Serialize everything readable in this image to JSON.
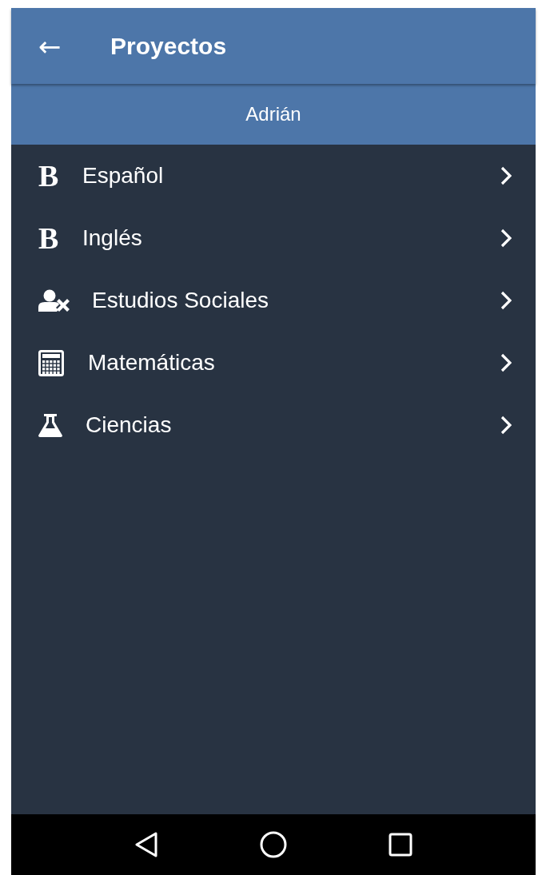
{
  "app_bar": {
    "back_icon": "←",
    "title": "Proyectos"
  },
  "subheader": {
    "name": "Adrián"
  },
  "items": [
    {
      "kind": "letter",
      "glyph": "B",
      "label": "Español"
    },
    {
      "kind": "letter",
      "glyph": "B",
      "label": "Inglés"
    },
    {
      "kind": "person-x",
      "label": "Estudios Sociales"
    },
    {
      "kind": "calculator",
      "label": "Matemáticas"
    },
    {
      "kind": "flask",
      "label": "Ciencias"
    }
  ]
}
